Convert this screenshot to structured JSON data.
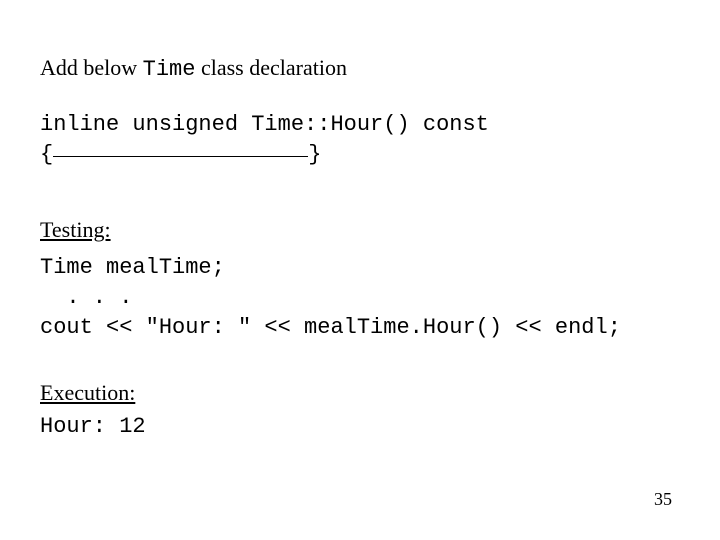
{
  "intro": {
    "prefix": "Add below ",
    "code_word": "Time",
    "suffix": " class declaration"
  },
  "code1": {
    "line1": "inline unsigned Time::Hour() const",
    "brace_open": "{",
    "brace_close": "}"
  },
  "testing": {
    "heading": "Testing:",
    "code": "Time mealTime;\n  . . .\ncout << \"Hour: \" << mealTime.Hour() << endl;"
  },
  "execution": {
    "heading": "Execution:",
    "output": "Hour: 12"
  },
  "page_number": "35"
}
